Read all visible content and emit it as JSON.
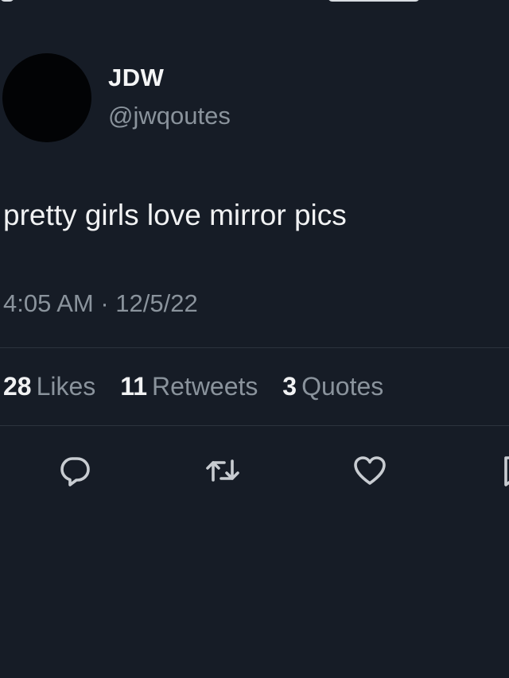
{
  "colors": {
    "background": "#161c26",
    "primary_text": "#f1f2f3",
    "secondary_text": "#8a939c",
    "divider": "#2c333d",
    "icon": "#c8ccd1"
  },
  "tweet": {
    "display_name": "JDW",
    "handle": "@jwqoutes",
    "text": "pretty girls love mirror pics",
    "timestamp": "4:05 AM · 12/5/22"
  },
  "stats": {
    "likes": {
      "count": "28",
      "label": "Likes"
    },
    "retweets": {
      "count": "11",
      "label": "Retweets"
    },
    "quotes": {
      "count": "3",
      "label": "Quotes"
    }
  },
  "actions": [
    "reply-icon",
    "retweet-icon",
    "like-icon",
    "bookmark-icon"
  ]
}
